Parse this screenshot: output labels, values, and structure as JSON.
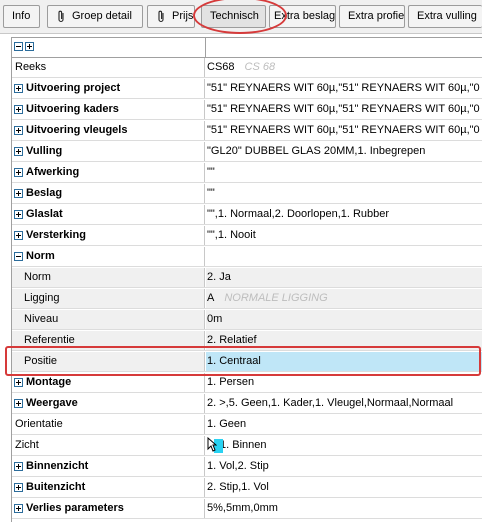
{
  "toolbar": {
    "info": "Info",
    "groep_detail": "Groep detail",
    "prijs": "Prijs",
    "technisch": "Technisch",
    "extra_beslag": "Extra beslag",
    "extra_profiel": "Extra profiel",
    "extra_vulling": "Extra vulling",
    "active_tab": "Technisch"
  },
  "rows": [
    {
      "label": "Reeks",
      "value": "CS68",
      "hint": "CS 68",
      "kind": "plain"
    },
    {
      "label": "Uitvoering project",
      "value": "\"51\" REYNAERS WIT 60µ,\"51\" REYNAERS WIT 60µ,\"0",
      "kind": "group"
    },
    {
      "label": "Uitvoering kaders",
      "value": "\"51\" REYNAERS WIT 60µ,\"51\" REYNAERS WIT 60µ,\"0",
      "kind": "group"
    },
    {
      "label": "Uitvoering vleugels",
      "value": "\"51\" REYNAERS WIT 60µ,\"51\" REYNAERS WIT 60µ,\"0",
      "kind": "group"
    },
    {
      "label": "Vulling",
      "value": "\"GL20\" DUBBEL GLAS 20MM,1. Inbegrepen",
      "kind": "group"
    },
    {
      "label": "Afwerking",
      "value": "\"\"",
      "kind": "group"
    },
    {
      "label": "Beslag",
      "value": "\"\"",
      "kind": "group"
    },
    {
      "label": "Glaslat",
      "value": "\"\",1. Normaal,2. Doorlopen,1. Rubber",
      "kind": "group"
    },
    {
      "label": "Versterking",
      "value": "\"\",1. Nooit",
      "kind": "group"
    },
    {
      "label": "Norm",
      "value": "",
      "kind": "group-open"
    },
    {
      "label": "Norm",
      "value": "2. Ja",
      "kind": "child"
    },
    {
      "label": "Ligging",
      "value": "A",
      "hint": "NORMALE LIGGING",
      "kind": "child"
    },
    {
      "label": "Niveau",
      "value": "0m",
      "kind": "child"
    },
    {
      "label": "Referentie",
      "value": "2. Relatief",
      "kind": "child"
    },
    {
      "label": "Positie",
      "value": "1. Centraal",
      "kind": "child-selected"
    },
    {
      "label": "Montage",
      "value": "1. Persen",
      "kind": "group"
    },
    {
      "label": "Weergave",
      "value": "2. >,5. Geen,1. Kader,1. Vleugel,Normaal,Normaal",
      "kind": "group"
    },
    {
      "label": "Orientatie",
      "value": "1. Geen",
      "kind": "plain"
    },
    {
      "label": "Zicht",
      "value": "1. Binnen",
      "kind": "plain-icon"
    },
    {
      "label": "Binnenzicht",
      "value": "1. Vol,2. Stip",
      "kind": "group"
    },
    {
      "label": "Buitenzicht",
      "value": "2. Stip,1. Vol",
      "kind": "group"
    },
    {
      "label": "Verlies parameters",
      "value": "5%,5mm,0mm",
      "kind": "group"
    }
  ],
  "colors": {
    "selected_value_bg": "#bfe6f7",
    "callout_red": "#d63a3a",
    "child_row_bg": "#f0f0f0"
  }
}
